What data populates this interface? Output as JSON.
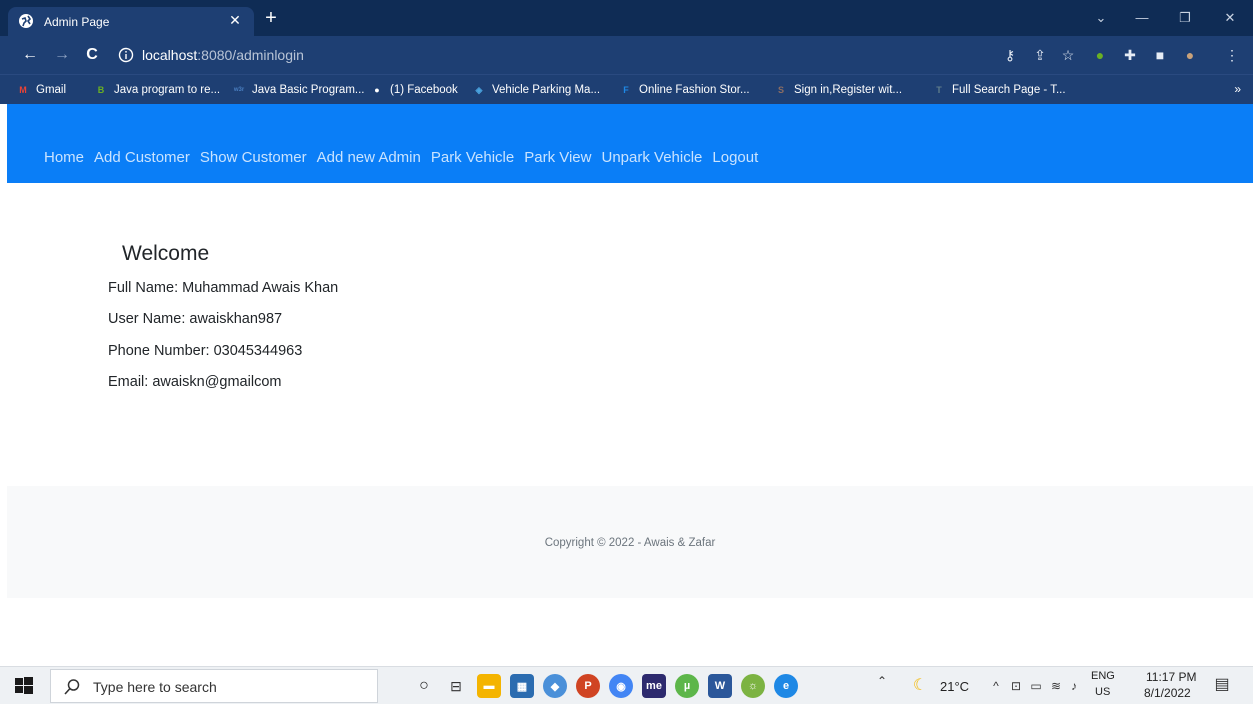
{
  "browser": {
    "tab_title": "Admin Page",
    "url_host": "localhost",
    "url_rest": ":8080/adminlogin"
  },
  "bookmarks": [
    {
      "label": "Gmail",
      "icon": "gmail-icon",
      "color": "#ea4335",
      "glyph": "M"
    },
    {
      "label": "Java program to re...",
      "icon": "bookmark-green-icon",
      "color": "#6ab023",
      "glyph": "B"
    },
    {
      "label": "Java Basic Program...",
      "icon": "w3r-icon",
      "color": "#4a7fc1",
      "glyph": "w3r"
    },
    {
      "label": "(1) Facebook",
      "icon": "globe-icon",
      "color": "#ffffff",
      "glyph": "●"
    },
    {
      "label": "Vehicle Parking Ma...",
      "icon": "parking-icon",
      "color": "#4aa3df",
      "glyph": "◈"
    },
    {
      "label": "Online Fashion Stor...",
      "icon": "fashion-icon",
      "color": "#1e88e5",
      "glyph": "F"
    },
    {
      "label": "Sign in,Register wit...",
      "icon": "signin-icon",
      "color": "#8d6e63",
      "glyph": "S"
    },
    {
      "label": "Full Search Page - T...",
      "icon": "search-page-icon",
      "color": "#607d8b",
      "glyph": "T"
    }
  ],
  "nav": {
    "links": [
      "Home",
      "Add Customer",
      "Show Customer",
      "Add new Admin",
      "Park Vehicle",
      "Park View",
      "Unpark Vehicle",
      "Logout"
    ]
  },
  "profile": {
    "heading": "Welcome",
    "full_name": "Full Name: Muhammad Awais Khan",
    "user_name": "User Name: awaiskhan987",
    "phone": "Phone Number: 03045344963",
    "email": "Email: awaiskn@gmailcom"
  },
  "footer": {
    "copyright": "Copyright © 2022 - Awais & Zafar"
  },
  "taskbar": {
    "search_placeholder": "Type here to search",
    "temperature": "21°C",
    "lang_top": "ENG",
    "lang_bottom": "US",
    "time": "11:17 PM",
    "date": "8/1/2022"
  },
  "colors": {
    "navbar": "#0a7ef7",
    "chrome_dark": "#0f2c55",
    "chrome": "#1e3f73",
    "footer_bg": "#f8f9fa"
  }
}
